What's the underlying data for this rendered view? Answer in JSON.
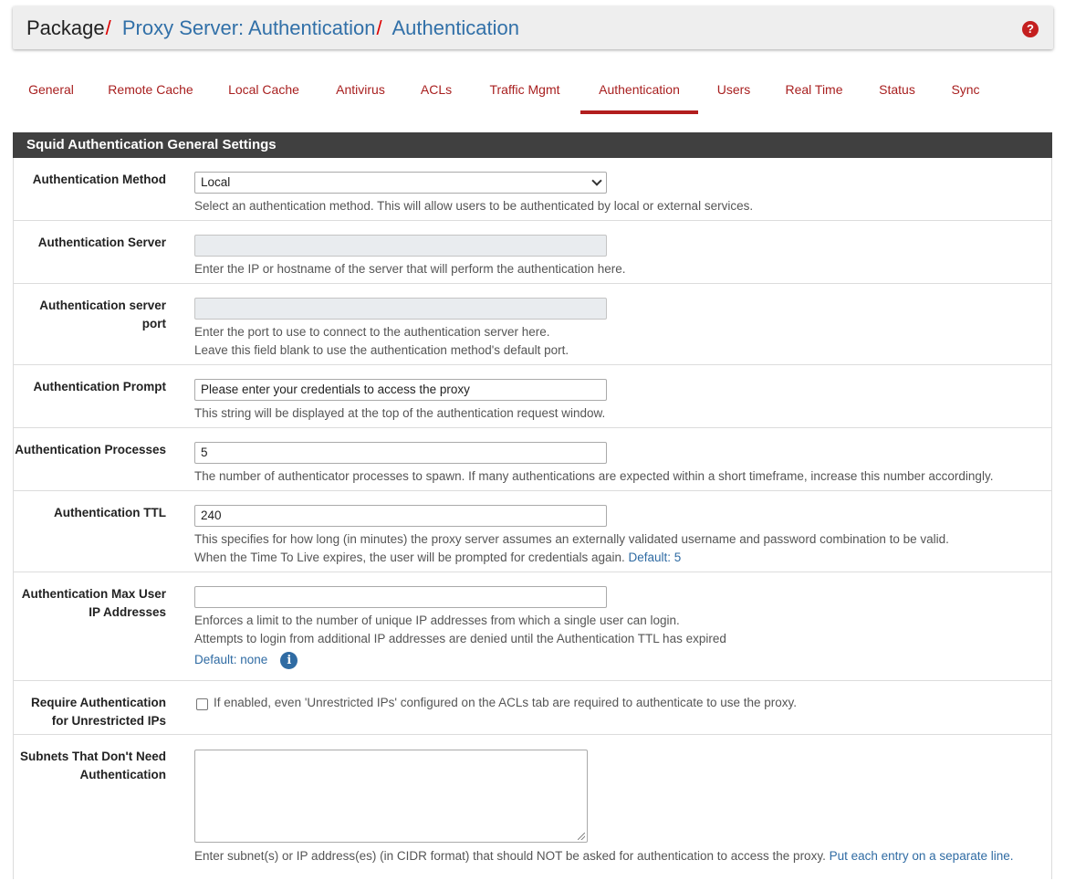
{
  "breadcrumb": {
    "items": [
      "Package",
      "Proxy Server: Authentication",
      "Authentication"
    ],
    "separator": "/"
  },
  "help_icon": "question-circle-icon",
  "tabs": [
    {
      "label": "General"
    },
    {
      "label": "Remote Cache"
    },
    {
      "label": "Local Cache"
    },
    {
      "label": "Antivirus"
    },
    {
      "label": "ACLs"
    },
    {
      "label": "Traffic Mgmt"
    },
    {
      "label": "Authentication",
      "active": true
    },
    {
      "label": "Users"
    },
    {
      "label": "Real Time"
    },
    {
      "label": "Status"
    },
    {
      "label": "Sync"
    }
  ],
  "panel": {
    "title": "Squid Authentication General Settings"
  },
  "fields": {
    "method": {
      "label": "Authentication Method",
      "value": "Local",
      "help": "Select an authentication method. This will allow users to be authenticated by local or external services."
    },
    "server": {
      "label": "Authentication Server",
      "value": "",
      "help": "Enter the IP or hostname of the server that will perform the authentication here."
    },
    "port": {
      "label_line1": "Authentication server",
      "label_line2": "port",
      "value": "",
      "help1": "Enter the port to use to connect to the authentication server here.",
      "help2": "Leave this field blank to use the authentication method's default port."
    },
    "prompt": {
      "label": "Authentication Prompt",
      "value": "Please enter your credentials to access the proxy",
      "help": "This string will be displayed at the top of the authentication request window."
    },
    "processes": {
      "label": "Authentication Processes",
      "value": "5",
      "help": "The number of authenticator processes to spawn. If many authentications are expected within a short timeframe, increase this number accordingly."
    },
    "ttl": {
      "label": "Authentication TTL",
      "value": "240",
      "help1": "This specifies for how long (in minutes) the proxy server assumes an externally validated username and password combination to be valid.",
      "help2": "When the Time To Live expires, the user will be prompted for credentials again.",
      "help2_default": "Default: 5"
    },
    "max_ip": {
      "label_line1": "Authentication Max User",
      "label_line2": "IP Addresses",
      "value": "",
      "help1": "Enforces a limit to the number of unique IP addresses from which a single user can login.",
      "help2": "Attempts to login from additional IP addresses are denied until the Authentication TTL has expired",
      "default": "Default: none",
      "info_icon": "info-circle-icon"
    },
    "require_auth": {
      "label_line1": "Require Authentication",
      "label_line2": "for Unrestricted IPs",
      "checked": false,
      "help": "If enabled, even 'Unrestricted IPs' configured on the ACLs tab are required to authenticate to use the proxy."
    },
    "subnets": {
      "label_line1": "Subnets That Don't Need",
      "label_line2": "Authentication",
      "value": "",
      "help": "Enter subnet(s) or IP address(es) (in CIDR format) that should NOT be asked for authentication to access the proxy.",
      "help_link": "Put each entry on a separate line."
    }
  }
}
